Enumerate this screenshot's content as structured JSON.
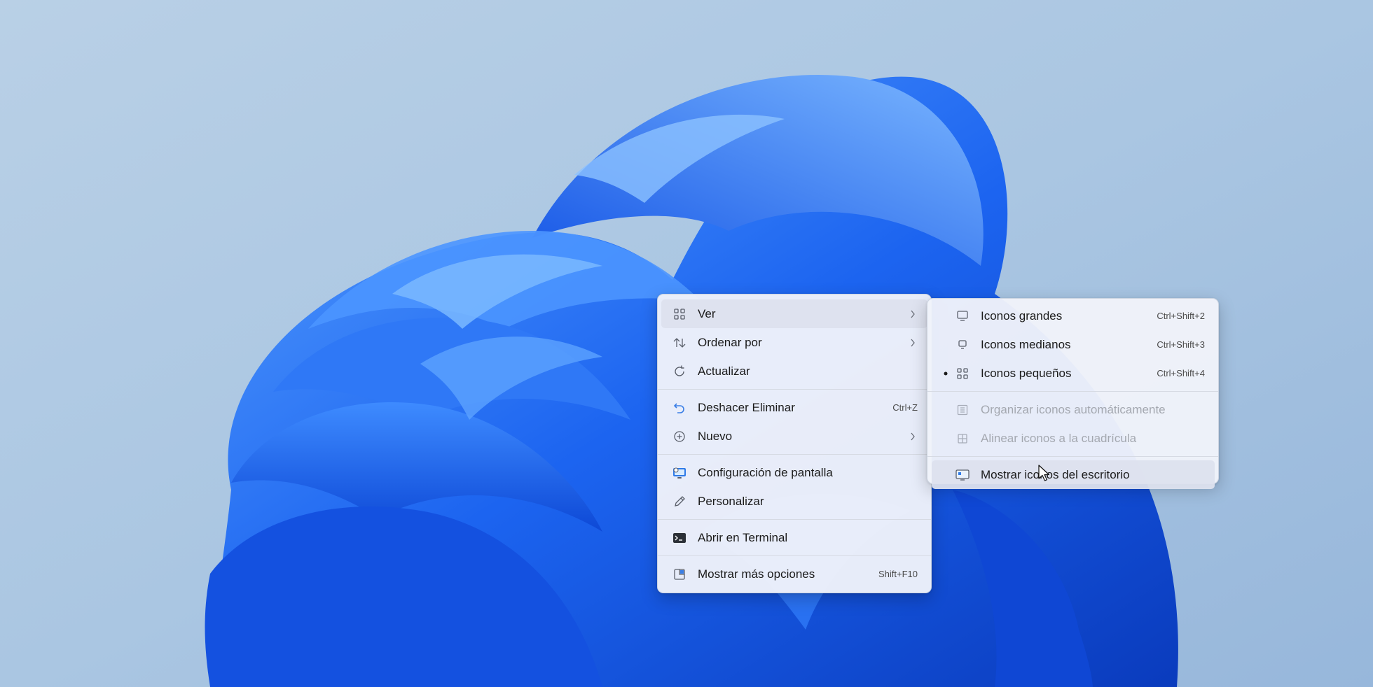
{
  "context_menu": {
    "items": [
      {
        "label": "Ver",
        "icon": "grid-icon",
        "submenu": true
      },
      {
        "label": "Ordenar por",
        "icon": "sort-icon",
        "submenu": true
      },
      {
        "label": "Actualizar",
        "icon": "refresh-icon"
      },
      {
        "label": "Deshacer Eliminar",
        "icon": "undo-icon",
        "shortcut": "Ctrl+Z"
      },
      {
        "label": "Nuevo",
        "icon": "plus-circle-icon",
        "submenu": true
      },
      {
        "label": "Configuración de pantalla",
        "icon": "display-settings-icon"
      },
      {
        "label": "Personalizar",
        "icon": "pencil-icon"
      },
      {
        "label": "Abrir en Terminal",
        "icon": "terminal-icon"
      },
      {
        "label": "Mostrar más opciones",
        "icon": "more-options-icon",
        "shortcut": "Shift+F10"
      }
    ]
  },
  "view_submenu": {
    "items": [
      {
        "label": "Iconos grandes",
        "icon": "monitor-large-icon",
        "shortcut": "Ctrl+Shift+2"
      },
      {
        "label": "Iconos medianos",
        "icon": "monitor-medium-icon",
        "shortcut": "Ctrl+Shift+3"
      },
      {
        "label": "Iconos pequeños",
        "icon": "grid-small-icon",
        "shortcut": "Ctrl+Shift+4",
        "selected": true
      },
      {
        "label": "Organizar iconos automáticamente",
        "icon": "auto-arrange-icon",
        "disabled": true
      },
      {
        "label": "Alinear iconos a la cuadrícula",
        "icon": "align-grid-icon",
        "disabled": true
      },
      {
        "label": "Mostrar iconos del escritorio",
        "icon": "show-desktop-icons-icon",
        "hovered": true
      }
    ]
  },
  "colors": {
    "menu_background": "#f0f3fa",
    "highlight": "#dde2ee",
    "text": "#1b1b1b",
    "disabled_text": "#a4a8b0",
    "wallpaper_accent": "#1a5ff0"
  }
}
